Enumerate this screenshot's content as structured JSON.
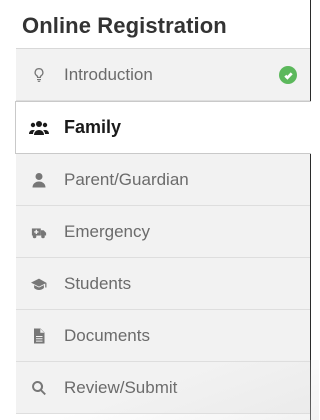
{
  "panel": {
    "title": "Online Registration"
  },
  "nav": {
    "items": [
      {
        "label": "Introduction",
        "icon": "lightbulb-icon",
        "completed": true
      },
      {
        "label": "Family",
        "icon": "users-icon",
        "active": true
      },
      {
        "label": "Parent/Guardian",
        "icon": "user-icon"
      },
      {
        "label": "Emergency",
        "icon": "ambulance-icon"
      },
      {
        "label": "Students",
        "icon": "graduation-cap-icon"
      },
      {
        "label": "Documents",
        "icon": "document-icon"
      },
      {
        "label": "Review/Submit",
        "icon": "search-icon"
      }
    ]
  },
  "colors": {
    "completed_check": "#5cb85c",
    "inactive_bg": "#f2f2f2",
    "active_bg": "#ffffff",
    "inactive_text": "#6b6b6b",
    "active_text": "#1a1a1a"
  }
}
